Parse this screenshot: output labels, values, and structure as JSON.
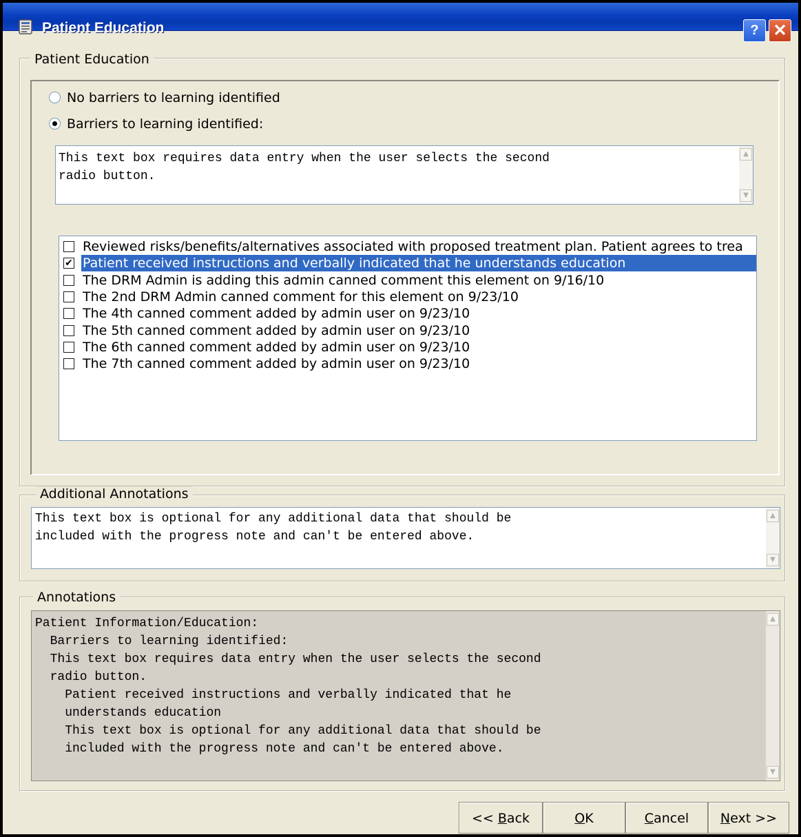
{
  "window": {
    "title": "Patient Education"
  },
  "titlebar": {
    "help_label": "?",
    "close_label": "✕"
  },
  "education_group": {
    "label": "Patient Education",
    "radio_no_barriers": "No barriers to learning identified",
    "radio_barriers": "Barriers to learning identified:",
    "selected_radio": "barriers",
    "barriers_text_line1": "This text box requires data entry when the user selects the second",
    "barriers_text_line2": "radio button.",
    "checklist": [
      {
        "label": "Reviewed risks/benefits/alternatives associated with proposed treatment plan. Patient agrees to trea",
        "checked": false,
        "selected": false
      },
      {
        "label": "Patient received instructions and verbally indicated that he understands education",
        "checked": true,
        "selected": true
      },
      {
        "label": "The DRM Admin is adding this admin canned comment this element on 9/16/10",
        "checked": false,
        "selected": false
      },
      {
        "label": "The 2nd DRM Admin canned comment for this element on 9/23/10",
        "checked": false,
        "selected": false
      },
      {
        "label": "The 4th canned comment added by admin user on 9/23/10",
        "checked": false,
        "selected": false
      },
      {
        "label": "The 5th canned comment added by admin user on 9/23/10",
        "checked": false,
        "selected": false
      },
      {
        "label": "The 6th canned comment added by admin user on 9/23/10",
        "checked": false,
        "selected": false
      },
      {
        "label": "The 7th canned comment added by admin user on 9/23/10",
        "checked": false,
        "selected": false
      }
    ]
  },
  "additional_annotations": {
    "label": "Additional Annotations",
    "line1": "This text box is optional for any additional data that should be",
    "line2": "included with the progress note and can't be entered above."
  },
  "annotations": {
    "label": "Annotations",
    "lines": [
      "Patient Information/Education:",
      "  Barriers to learning identified:",
      "  This text box requires data entry when the user selects the second",
      "  radio button.",
      "    Patient received instructions and verbally indicated that he",
      "    understands education",
      "    This text box is optional for any additional data that should be",
      "    included with the progress note and can't be entered above."
    ]
  },
  "buttons": {
    "back_prefix": "<< ",
    "back_key": "B",
    "back_rest": "ack",
    "ok_key": "O",
    "ok_rest": "K",
    "cancel_key": "C",
    "cancel_rest": "ancel",
    "next_key": "N",
    "next_rest": "ext >>"
  },
  "colors": {
    "selection": "#316ac5",
    "titlebar": "#0a3fc0",
    "dialog_bg": "#ece9d8"
  }
}
